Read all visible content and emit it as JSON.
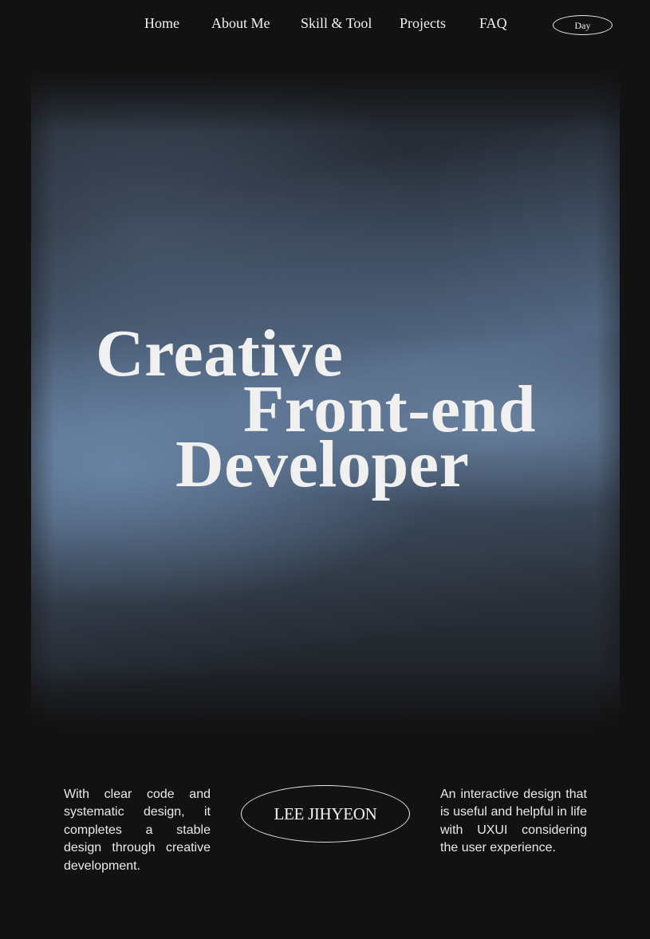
{
  "nav": {
    "items": [
      {
        "label": "Home"
      },
      {
        "label": "About Me"
      },
      {
        "label": "Skill & Tool"
      },
      {
        "label": "Projects"
      },
      {
        "label": "FAQ"
      }
    ],
    "theme_toggle": "Day"
  },
  "hero": {
    "line1": "Creative",
    "line2": "Front-end",
    "line3": "Developer"
  },
  "intro": {
    "left_text": "With clear code and systematic design, it completes a stable design through creative development.",
    "name": "LEE JIHYEON",
    "right_text": "An interactive design that is useful and helpful in life with UXUI considering the user experience."
  },
  "colors": {
    "background": "#121212",
    "text": "#f2f2f2",
    "hero_accent": "#6c88aa"
  }
}
